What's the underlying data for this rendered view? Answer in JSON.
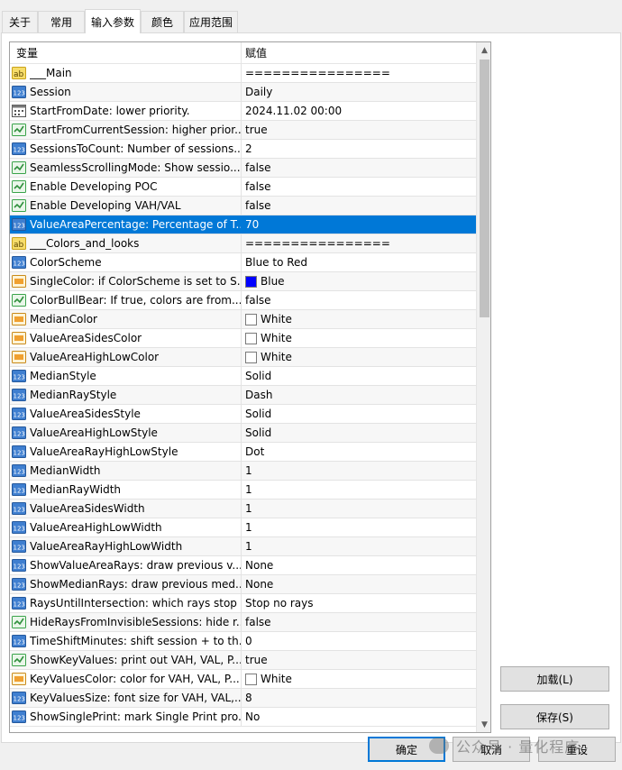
{
  "tabs": [
    {
      "label": "关于"
    },
    {
      "label": "常用"
    },
    {
      "label": "输入参数"
    },
    {
      "label": "颜色"
    },
    {
      "label": "应用范围"
    }
  ],
  "active_tab": "输入参数",
  "grid": {
    "header_variable": "变量",
    "header_value": "赋值",
    "rows": [
      {
        "icon": "ab",
        "name": "___Main",
        "value": "================"
      },
      {
        "icon": "123",
        "name": "Session",
        "value": "Daily"
      },
      {
        "icon": "cal",
        "name": "StartFromDate: lower priority.",
        "value": "2024.11.02 00:00"
      },
      {
        "icon": "bool",
        "name": "StartFromCurrentSession: higher prior...",
        "value": "true"
      },
      {
        "icon": "123",
        "name": "SessionsToCount: Number of sessions...",
        "value": "2"
      },
      {
        "icon": "bool",
        "name": "SeamlessScrollingMode: Show sessio...",
        "value": "false"
      },
      {
        "icon": "bool",
        "name": "Enable Developing POC",
        "value": "false"
      },
      {
        "icon": "bool",
        "name": "Enable Developing VAH/VAL",
        "value": "false"
      },
      {
        "icon": "123",
        "name": "ValueAreaPercentage: Percentage of T...",
        "value": "70",
        "selected": true
      },
      {
        "icon": "ab",
        "name": "___Colors_and_looks",
        "value": "================"
      },
      {
        "icon": "123",
        "name": "ColorScheme",
        "value": "Blue to Red"
      },
      {
        "icon": "color",
        "name": "SingleColor: if ColorScheme is set to S...",
        "value": "Blue",
        "swatch": "#0000ff"
      },
      {
        "icon": "bool",
        "name": "ColorBullBear: If true, colors are from...",
        "value": "false"
      },
      {
        "icon": "color",
        "name": "MedianColor",
        "value": "White",
        "swatch": "#ffffff"
      },
      {
        "icon": "color",
        "name": "ValueAreaSidesColor",
        "value": "White",
        "swatch": "#ffffff"
      },
      {
        "icon": "color",
        "name": "ValueAreaHighLowColor",
        "value": "White",
        "swatch": "#ffffff"
      },
      {
        "icon": "123",
        "name": "MedianStyle",
        "value": "Solid"
      },
      {
        "icon": "123",
        "name": "MedianRayStyle",
        "value": "Dash"
      },
      {
        "icon": "123",
        "name": "ValueAreaSidesStyle",
        "value": "Solid"
      },
      {
        "icon": "123",
        "name": "ValueAreaHighLowStyle",
        "value": "Solid"
      },
      {
        "icon": "123",
        "name": "ValueAreaRayHighLowStyle",
        "value": "Dot"
      },
      {
        "icon": "123",
        "name": "MedianWidth",
        "value": "1"
      },
      {
        "icon": "123",
        "name": "MedianRayWidth",
        "value": "1"
      },
      {
        "icon": "123",
        "name": "ValueAreaSidesWidth",
        "value": "1"
      },
      {
        "icon": "123",
        "name": "ValueAreaHighLowWidth",
        "value": "1"
      },
      {
        "icon": "123",
        "name": "ValueAreaRayHighLowWidth",
        "value": "1"
      },
      {
        "icon": "123",
        "name": "ShowValueAreaRays: draw previous v...",
        "value": "None"
      },
      {
        "icon": "123",
        "name": "ShowMedianRays: draw previous med...",
        "value": "None"
      },
      {
        "icon": "123",
        "name": "RaysUntilIntersection: which rays stop ...",
        "value": "Stop no rays"
      },
      {
        "icon": "bool",
        "name": "HideRaysFromInvisibleSessions: hide r...",
        "value": "false"
      },
      {
        "icon": "123",
        "name": "TimeShiftMinutes: shift session + to th...",
        "value": "0"
      },
      {
        "icon": "bool",
        "name": "ShowKeyValues: print out VAH, VAL, P...",
        "value": "true"
      },
      {
        "icon": "color",
        "name": "KeyValuesColor: color for VAH, VAL, P...",
        "value": "White",
        "swatch": "#ffffff"
      },
      {
        "icon": "123",
        "name": "KeyValuesSize: font size for VAH, VAL,...",
        "value": "8"
      },
      {
        "icon": "123",
        "name": "ShowSinglePrint: mark Single Print pro...",
        "value": "No"
      }
    ]
  },
  "buttons": {
    "load": "加载(L)",
    "save": "保存(S)",
    "ok": "确定",
    "cancel": "取消",
    "reset": "重设"
  },
  "watermark": "公众号 · 量化程序",
  "colors": {
    "selection": "#0078d7",
    "primary_border": "#0078d7",
    "bool_icon_green": "#3aa34a",
    "num_icon_blue": "#2f6fc2",
    "ab_icon_yellow": "#e8c640"
  }
}
